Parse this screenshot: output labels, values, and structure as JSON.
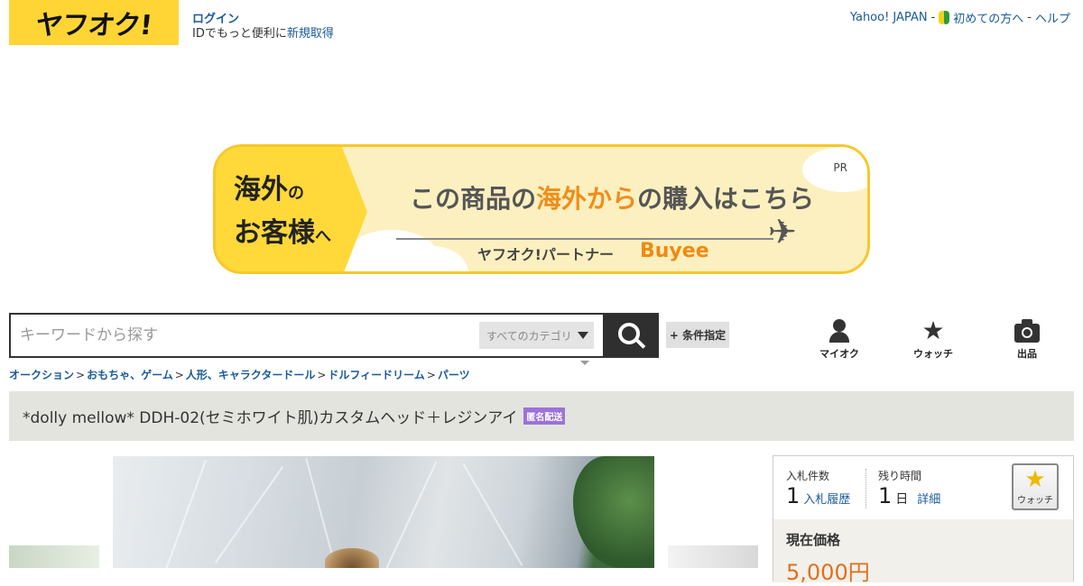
{
  "header": {
    "logo_text": "ヤフオク!",
    "login_label": "ログイン",
    "login_sub_text": "IDでもっと便利に",
    "register_link": "新規取得",
    "right_links": [
      "Yahoo! JAPAN",
      "初めての方へ",
      "ヘルプ"
    ],
    "separator": "-"
  },
  "banner": {
    "left_line1_big": "海外",
    "left_line1_small": "の",
    "left_line2_big": "お客様",
    "left_line2_small": "へ",
    "pr": "PR",
    "main_text_before": "この商品の",
    "main_text_highlight": "海外から",
    "main_text_after": "の購入はこちら",
    "partner": "ヤフオク!パートナー",
    "partner_logo": "Buyee"
  },
  "search": {
    "placeholder": "キーワードから探す",
    "category": "すべてのカテゴリ",
    "conditions_button": "+ 条件指定"
  },
  "nav": {
    "myauc": "マイオク",
    "watch": "ウォッチ",
    "sell": "出品"
  },
  "breadcrumb": [
    "オークション",
    "おもちゃ、ゲーム",
    "人形、キャラクタードール",
    "ドルフィードリーム",
    "パーツ"
  ],
  "breadcrumb_sep": ">",
  "item": {
    "title": "*dolly mellow* DDH-02(セミホワイト肌)カスタムヘッド＋レジンアイ",
    "badge": "匿名配送"
  },
  "bid": {
    "bids_label": "入札件数",
    "bids_value": "1",
    "bids_link": "入札履歴",
    "time_label": "残り時間",
    "time_value": "1",
    "time_unit": "日",
    "time_link": "詳細",
    "watch_label": "ウォッチ",
    "price_label": "現在価格",
    "price_value": "5,000円"
  },
  "colors": {
    "accent_yellow": "#ffd535",
    "link_blue": "#1a5a9a",
    "badge_purple": "#9b73d8",
    "price_orange": "#e0701a"
  }
}
